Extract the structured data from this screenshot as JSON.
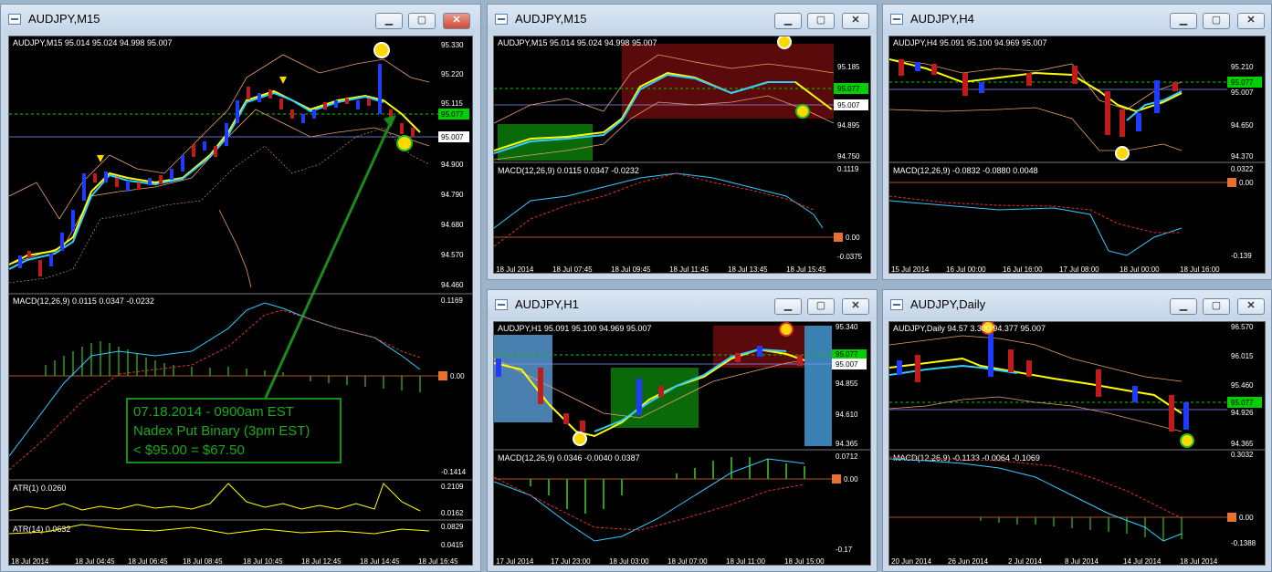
{
  "windows": {
    "w1": {
      "title": "AUDJPY,M15",
      "header": "AUDJPY,M15  95.014 95.024 94.998 95.007",
      "prices": [
        "95.330",
        "95.220",
        "95.115",
        "95.077",
        "95.007",
        "94.900",
        "94.790",
        "94.680",
        "94.570",
        "94.460"
      ],
      "macd": {
        "header": "MACD(12,26,9) 0.0115 0.0347 -0.0232",
        "top": "0.1169",
        "zero": "0.00",
        "bottom": "-0.1414"
      },
      "atr1": {
        "header": "ATR(1) 0.0260",
        "top": "0.2109",
        "bottom": "0.0162"
      },
      "atr14": {
        "header": "ATR(14) 0.0632",
        "top": "0.0829",
        "bottom": "0.0415"
      },
      "times": [
        "18 Jul 2014",
        "18 Jul 04:45",
        "18 Jul 06:45",
        "18 Jul 08:45",
        "18 Jul 10:45",
        "18 Jul 12:45",
        "18 Jul 14:45",
        "18 Jul 16:45"
      ],
      "note": [
        "07.18.2014 - 0900am EST",
        "Nadex Put Binary (3pm EST)",
        "< $95.00 = $67.50"
      ]
    },
    "w2": {
      "title": "AUDJPY,M15",
      "header": "AUDJPY,M15  95.014 95.024 94.998 95.007",
      "prices": [
        "95.185",
        "95.077",
        "95.007",
        "94.895",
        "94.750"
      ],
      "macd": {
        "header": "MACD(12,26,9) 0.0115 0.0347 -0.0232",
        "top": "0.1119",
        "zero": "0.00",
        "bottom": "-0.0375"
      },
      "times": [
        "18 Jul 2014",
        "18 Jul 07:45",
        "18 Jul 09:45",
        "18 Jul 11:45",
        "18 Jul 13:45",
        "18 Jul 15:45"
      ]
    },
    "w3": {
      "title": "AUDJPY,H4",
      "header": "AUDJPY,H4  95.091 95.100 94.969 95.007",
      "prices": [
        "95.210",
        "95.077",
        "95.007",
        "94.650",
        "94.370"
      ],
      "macd": {
        "header": "MACD(12,26,9) -0.0832 -0.0880 0.0048",
        "top": "0.0322",
        "zero": "0.00",
        "bottom": "-0.139"
      },
      "times": [
        "15 Jul 2014",
        "16 Jul 00:00",
        "16 Jul 16:00",
        "17 Jul 08:00",
        "18 Jul 00:00",
        "18 Jul 16:00"
      ]
    },
    "w4": {
      "title": "AUDJPY,H1",
      "header": "AUDJPY,H1  95.091 95.100 94.969 95.007",
      "prices": [
        "95.340",
        "95.077",
        "95.007",
        "94.855",
        "94.610",
        "94.365"
      ],
      "macd": {
        "header": "MACD(12,26,9) 0.0346 -0.0040 0.0387",
        "top": "0.0712",
        "zero": "0.00",
        "bottom": "-0.17"
      },
      "times": [
        "17 Jul 2014",
        "17 Jul 23:00",
        "18 Jul 03:00",
        "18 Jul 07:00",
        "18 Jul 11:00",
        "18 Jul 15:00"
      ]
    },
    "w5": {
      "title": "AUDJPY,Daily",
      "header": "AUDJPY,Daily  94.57  3.300 94.377 95.007",
      "prices": [
        "96.570",
        "96.015",
        "95.460",
        "95.077",
        "94.926",
        "94.365"
      ],
      "macd": {
        "header": "MACD(12,26,9) -0.1133 -0.0064 -0.1069",
        "top": "0.3032",
        "zero": "0.00",
        "bottom": "-0.1388"
      },
      "times": [
        "20 Jun 2014",
        "26 Jun 2014",
        "2 Jul 2014",
        "8 Jul 2014",
        "14 Jul 2014",
        "18 Jul 2014"
      ]
    }
  },
  "buttons": {
    "minimize": "▁",
    "maximize": "▢",
    "close": "✕"
  },
  "colors": {
    "bull": "#1f3bff",
    "bear": "#c01a1a",
    "ma": "#ffff00",
    "ma2": "#33ccff",
    "band": "#e8a070",
    "macd": "#33ccff",
    "signal": "#e03030",
    "hist": "#2f9a1c",
    "current": "#00e000"
  }
}
